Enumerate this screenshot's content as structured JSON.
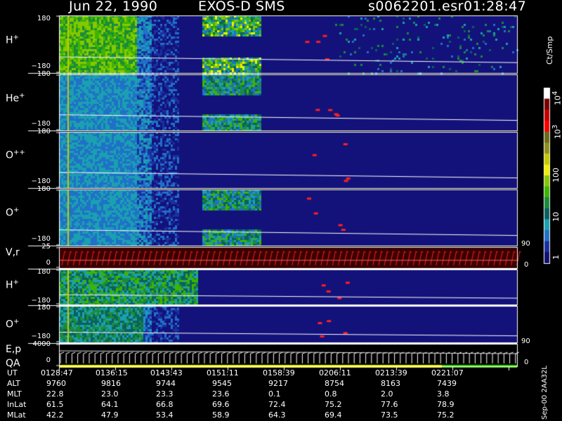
{
  "header": {
    "date": "Jun 22, 1990",
    "instrument": "EXOS-D SMS",
    "file": "s0062201.esr",
    "time": "01:28:47"
  },
  "colorbar": {
    "title": "Ct/Smp",
    "labels": [
      "10",
      "10",
      "100",
      "10",
      "1"
    ],
    "superscripts": [
      "4",
      "3",
      "",
      "",
      ""
    ],
    "colors": [
      "#ffffff",
      "#7a0000",
      "#c40000",
      "#ff0000",
      "#6a6a1a",
      "#8f8f1a",
      "#c8c800",
      "#f0f000",
      "#86c800",
      "#3db400",
      "#1a8c3a",
      "#0a6060",
      "#1aa0b0",
      "#2070c8",
      "#1a30a0",
      "#101070"
    ]
  },
  "panels": [
    {
      "label": "H",
      "sup": "+",
      "ymax": "180",
      "ymin": "−180"
    },
    {
      "label": "He",
      "sup": "+",
      "ymax": "180",
      "ymin": "−180"
    },
    {
      "label": "O",
      "sup": "++",
      "ymax": "180",
      "ymin": "−180"
    },
    {
      "label": "O",
      "sup": "+",
      "ymax": "180",
      "ymin": "−180"
    },
    {
      "label": "V,r",
      "sup": "",
      "ymax": "25",
      "ymin": "0",
      "right_top": "90",
      "right_bottom": "0"
    },
    {
      "label": "H",
      "sup": "+",
      "ymax": "180",
      "ymin": "−180"
    },
    {
      "label": "O",
      "sup": "+",
      "ymax": "180",
      "ymin": "−180",
      "right_top": "90"
    },
    {
      "label": "E,p",
      "label2": "QA",
      "sup": "",
      "ymax": "4000",
      "ymin": "0",
      "right_bottom": "0"
    }
  ],
  "footer": {
    "rows": [
      {
        "name": "UT",
        "values": [
          "0128:47",
          "0136:15",
          "0143:43",
          "0151:11",
          "0158:39",
          "0206:11",
          "0213:39",
          "0221:07"
        ]
      },
      {
        "name": "ALT",
        "values": [
          "9760",
          "9816",
          "9744",
          "9545",
          "9217",
          "8754",
          "8163",
          "7439"
        ]
      },
      {
        "name": "MLT",
        "values": [
          "22.8",
          "23.0",
          "23.3",
          "23.6",
          "0.1",
          "0.8",
          "2.0",
          "3.8"
        ]
      },
      {
        "name": "InLat",
        "values": [
          "61.5",
          "64.1",
          "66.8",
          "69.6",
          "72.4",
          "75.2",
          "77.6",
          "78.9"
        ]
      },
      {
        "name": "MLat",
        "values": [
          "42.2",
          "47.9",
          "53.4",
          "58.9",
          "64.3",
          "69.4",
          "73.5",
          "75.2"
        ]
      }
    ],
    "side_note": "Sep-00  2AA32L"
  },
  "chart_data": {
    "type": "heatmap",
    "title": "Jun 22, 1990   EXOS-D SMS",
    "colorbar_label": "Ct/Smp",
    "colorbar_scale": "log",
    "colorbar_range": [
      1,
      10000
    ],
    "x_axis": "UT",
    "x_ticks": [
      "0128:47",
      "0136:15",
      "0143:43",
      "0151:11",
      "0158:39",
      "0206:11",
      "0213:39",
      "0221:07"
    ],
    "panels": [
      {
        "species": "H+",
        "ylim": [
          -180,
          180
        ]
      },
      {
        "species": "He+",
        "ylim": [
          -180,
          180
        ]
      },
      {
        "species": "O++",
        "ylim": [
          -180,
          180
        ]
      },
      {
        "species": "O+",
        "ylim": [
          -180,
          180
        ]
      },
      {
        "species": "V,r",
        "ylim": [
          0,
          25
        ],
        "right_ylim": [
          0,
          90
        ]
      },
      {
        "species": "H+",
        "ylim": [
          -180,
          180
        ]
      },
      {
        "species": "O+",
        "ylim": [
          -180,
          180
        ]
      },
      {
        "species": "E,p / QA",
        "ylim": [
          0,
          4000
        ]
      }
    ]
  }
}
